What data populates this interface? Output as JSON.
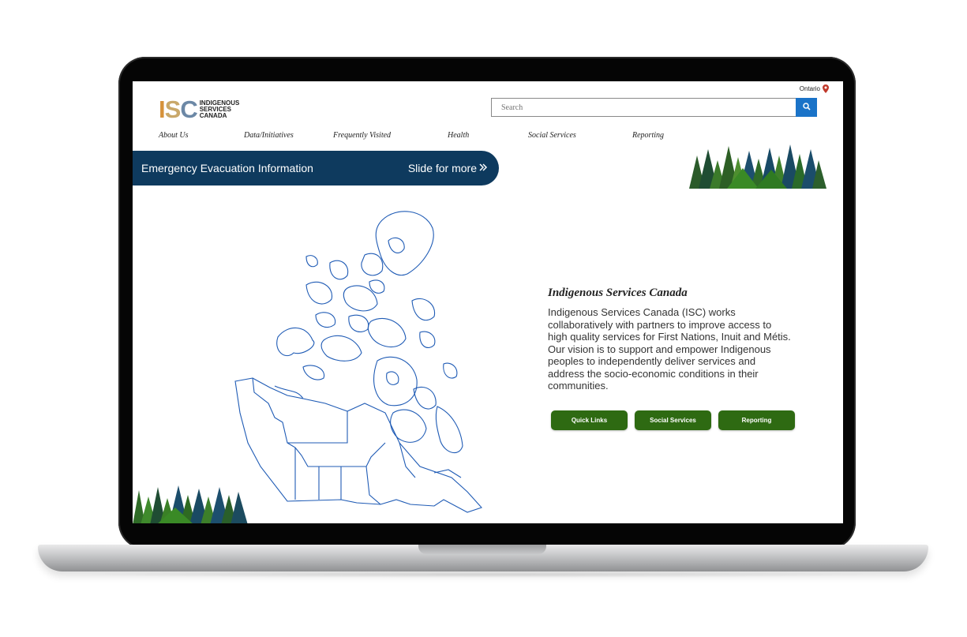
{
  "header": {
    "region": "Ontario",
    "logo": {
      "mark": "ISC",
      "line1": "INDIGENOUS",
      "line2": "SERVICES",
      "line3": "CANADA"
    },
    "search": {
      "placeholder": "Search"
    }
  },
  "nav": {
    "items": [
      {
        "label": "About Us"
      },
      {
        "label": "Data/Initiatives"
      },
      {
        "label": "Frequently Visited"
      },
      {
        "label": "Health"
      },
      {
        "label": "Social Services"
      },
      {
        "label": "Reporting"
      }
    ]
  },
  "banner": {
    "title": "Emergency Evacuation Information",
    "slide_label": "Slide for more"
  },
  "info": {
    "title": "Indigenous Services Canada",
    "body": "Indigenous Services Canada (ISC) works collaboratively with partners to improve access to high quality services for First Nations, Inuit and Métis. Our vision is to support and empower Indigenous peoples to independently deliver services and address the socio-economic conditions in their communities."
  },
  "actions": [
    {
      "label": "Quick Links"
    },
    {
      "label": "Social Services"
    },
    {
      "label": "Reporting"
    }
  ],
  "icons": {
    "region": "map-pin-icon",
    "search": "search-icon",
    "slide": "double-chevron-right-icon",
    "decor": "pine-trees-icon",
    "map": "canada-map-icon"
  },
  "colors": {
    "banner": "#0e3a5e",
    "button_green": "#2e6a12",
    "search_button": "#1a73c8",
    "pin": "#c0392b",
    "map_stroke": "#1f5bb5"
  }
}
